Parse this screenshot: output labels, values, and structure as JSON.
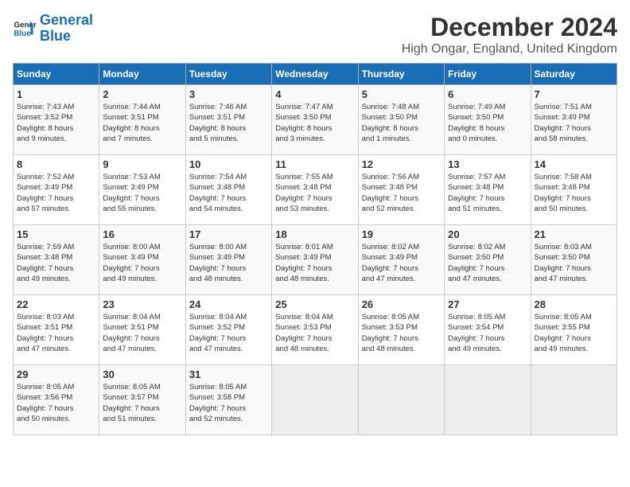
{
  "logo": {
    "line1": "General",
    "line2": "Blue"
  },
  "title": "December 2024",
  "subtitle": "High Ongar, England, United Kingdom",
  "days_of_week": [
    "Sunday",
    "Monday",
    "Tuesday",
    "Wednesday",
    "Thursday",
    "Friday",
    "Saturday"
  ],
  "weeks": [
    [
      {
        "day": "1",
        "sunrise": "7:43 AM",
        "sunset": "3:52 PM",
        "daylight_h": "8",
        "daylight_m": "9"
      },
      {
        "day": "2",
        "sunrise": "7:44 AM",
        "sunset": "3:51 PM",
        "daylight_h": "8",
        "daylight_m": "7"
      },
      {
        "day": "3",
        "sunrise": "7:46 AM",
        "sunset": "3:51 PM",
        "daylight_h": "8",
        "daylight_m": "5"
      },
      {
        "day": "4",
        "sunrise": "7:47 AM",
        "sunset": "3:50 PM",
        "daylight_h": "8",
        "daylight_m": "3"
      },
      {
        "day": "5",
        "sunrise": "7:48 AM",
        "sunset": "3:50 PM",
        "daylight_h": "8",
        "daylight_m": "1"
      },
      {
        "day": "6",
        "sunrise": "7:49 AM",
        "sunset": "3:50 PM",
        "daylight_h": "8",
        "daylight_m": "0"
      },
      {
        "day": "7",
        "sunrise": "7:51 AM",
        "sunset": "3:49 PM",
        "daylight_h": "7",
        "daylight_m": "58"
      }
    ],
    [
      {
        "day": "8",
        "sunrise": "7:52 AM",
        "sunset": "3:49 PM",
        "daylight_h": "7",
        "daylight_m": "57"
      },
      {
        "day": "9",
        "sunrise": "7:53 AM",
        "sunset": "3:49 PM",
        "daylight_h": "7",
        "daylight_m": "55"
      },
      {
        "day": "10",
        "sunrise": "7:54 AM",
        "sunset": "3:48 PM",
        "daylight_h": "7",
        "daylight_m": "54"
      },
      {
        "day": "11",
        "sunrise": "7:55 AM",
        "sunset": "3:48 PM",
        "daylight_h": "7",
        "daylight_m": "53"
      },
      {
        "day": "12",
        "sunrise": "7:56 AM",
        "sunset": "3:48 PM",
        "daylight_h": "7",
        "daylight_m": "52"
      },
      {
        "day": "13",
        "sunrise": "7:57 AM",
        "sunset": "3:48 PM",
        "daylight_h": "7",
        "daylight_m": "51"
      },
      {
        "day": "14",
        "sunrise": "7:58 AM",
        "sunset": "3:48 PM",
        "daylight_h": "7",
        "daylight_m": "50"
      }
    ],
    [
      {
        "day": "15",
        "sunrise": "7:59 AM",
        "sunset": "3:48 PM",
        "daylight_h": "7",
        "daylight_m": "49"
      },
      {
        "day": "16",
        "sunrise": "8:00 AM",
        "sunset": "3:49 PM",
        "daylight_h": "7",
        "daylight_m": "49"
      },
      {
        "day": "17",
        "sunrise": "8:00 AM",
        "sunset": "3:49 PM",
        "daylight_h": "7",
        "daylight_m": "48"
      },
      {
        "day": "18",
        "sunrise": "8:01 AM",
        "sunset": "3:49 PM",
        "daylight_h": "7",
        "daylight_m": "48"
      },
      {
        "day": "19",
        "sunrise": "8:02 AM",
        "sunset": "3:49 PM",
        "daylight_h": "7",
        "daylight_m": "47"
      },
      {
        "day": "20",
        "sunrise": "8:02 AM",
        "sunset": "3:50 PM",
        "daylight_h": "7",
        "daylight_m": "47"
      },
      {
        "day": "21",
        "sunrise": "8:03 AM",
        "sunset": "3:50 PM",
        "daylight_h": "7",
        "daylight_m": "47"
      }
    ],
    [
      {
        "day": "22",
        "sunrise": "8:03 AM",
        "sunset": "3:51 PM",
        "daylight_h": "7",
        "daylight_m": "47"
      },
      {
        "day": "23",
        "sunrise": "8:04 AM",
        "sunset": "3:51 PM",
        "daylight_h": "7",
        "daylight_m": "47"
      },
      {
        "day": "24",
        "sunrise": "8:04 AM",
        "sunset": "3:52 PM",
        "daylight_h": "7",
        "daylight_m": "47"
      },
      {
        "day": "25",
        "sunrise": "8:04 AM",
        "sunset": "3:53 PM",
        "daylight_h": "7",
        "daylight_m": "48"
      },
      {
        "day": "26",
        "sunrise": "8:05 AM",
        "sunset": "3:53 PM",
        "daylight_h": "7",
        "daylight_m": "48"
      },
      {
        "day": "27",
        "sunrise": "8:05 AM",
        "sunset": "3:54 PM",
        "daylight_h": "7",
        "daylight_m": "49"
      },
      {
        "day": "28",
        "sunrise": "8:05 AM",
        "sunset": "3:55 PM",
        "daylight_h": "7",
        "daylight_m": "49"
      }
    ],
    [
      {
        "day": "29",
        "sunrise": "8:05 AM",
        "sunset": "3:56 PM",
        "daylight_h": "7",
        "daylight_m": "50"
      },
      {
        "day": "30",
        "sunrise": "8:05 AM",
        "sunset": "3:57 PM",
        "daylight_h": "7",
        "daylight_m": "51"
      },
      {
        "day": "31",
        "sunrise": "8:05 AM",
        "sunset": "3:58 PM",
        "daylight_h": "7",
        "daylight_m": "52"
      },
      null,
      null,
      null,
      null
    ]
  ],
  "labels": {
    "sunrise": "Sunrise:",
    "sunset": "Sunset:",
    "daylight": "Daylight:"
  }
}
